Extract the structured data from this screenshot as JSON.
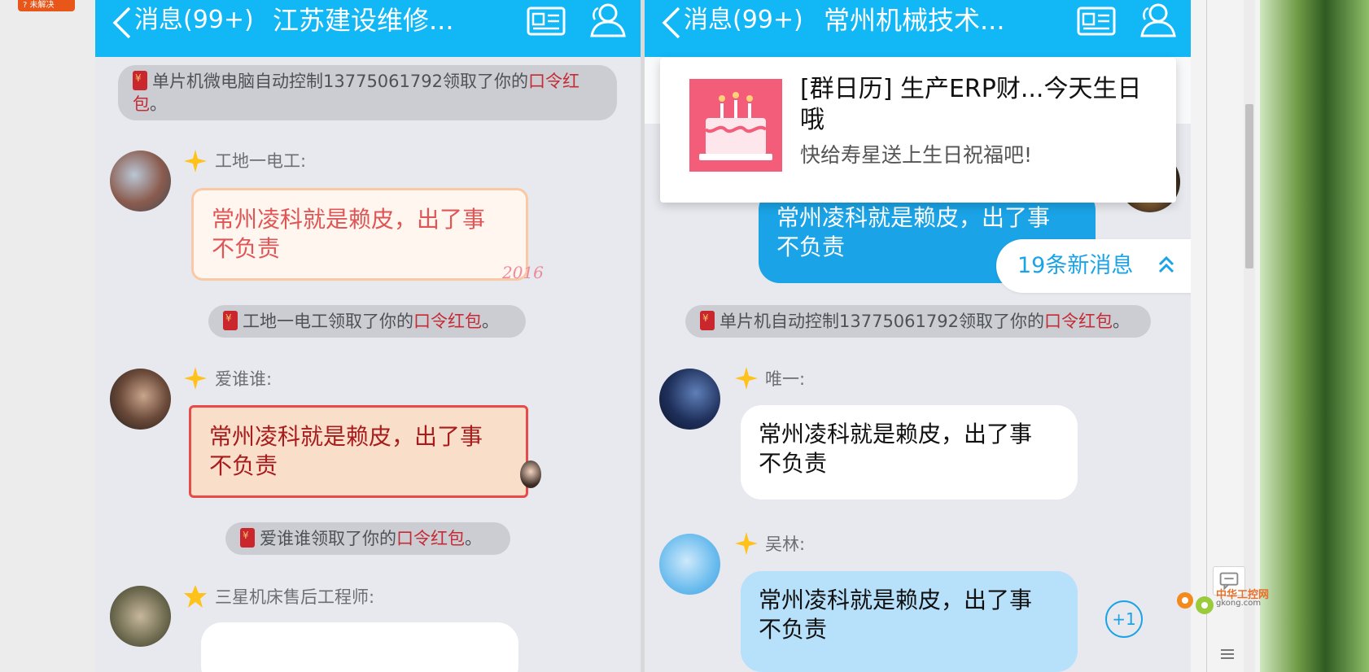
{
  "corner_badge": "? 未解决",
  "left_chat": {
    "back_label": "消息(99+)",
    "title": "江苏建设维修...",
    "notices": [
      {
        "prefix": "单片机微电脑自动控制13775061792领取了你的",
        "highlight": "口令红包",
        "suffix": "。"
      },
      {
        "prefix": "工地一电工领取了你的",
        "highlight": "口令红包",
        "suffix": "。"
      },
      {
        "prefix": "爱谁谁领取了你的",
        "highlight": "口令红包",
        "suffix": "。"
      }
    ],
    "messages": [
      {
        "sender": "工地一电工:",
        "text_line1": "常州凌科就是赖皮，出了事",
        "text_line2": "不负责",
        "sticker_text": "2016"
      },
      {
        "sender": "爱谁谁:",
        "text_line1": "常州凌科就是赖皮，出了事",
        "text_line2": "不负责"
      },
      {
        "sender": "三星机床售后工程师:"
      }
    ]
  },
  "right_chat": {
    "back_label": "消息(99+)",
    "title": "常州机械技术...",
    "popup": {
      "title": "[群日历] 生产ERP财...今天生日哦",
      "subtitle": "快给寿星送上生日祝福吧!"
    },
    "new_messages": "19条新消息",
    "notices": [
      {
        "prefix": "单片机自动控制13775061792领取了你的",
        "highlight": "口令红包",
        "suffix": "。"
      }
    ],
    "messages": [
      {
        "sender": "",
        "text_line1": "常州凌科就是赖皮，出了事",
        "text_line2": "不负责"
      },
      {
        "sender": "唯一:",
        "text_line1": "常州凌科就是赖皮，出了事",
        "text_line2": "不负责"
      },
      {
        "sender": "吴林:",
        "text_line1": "常州凌科就是赖皮，出了事",
        "text_line2": "不负责"
      }
    ],
    "plus_one": "+1"
  },
  "watermark": {
    "name": "中华工控网",
    "url": "gkong.com"
  },
  "colors": {
    "titlebar": "#12b7f5",
    "highlight": "#c42b35",
    "outgoing_bubble": "#1aa3e6"
  },
  "icons": [
    "chevron-left-icon",
    "contact-card-icon",
    "group-members-icon",
    "red-packet-icon",
    "vip-star-icon",
    "birthday-cake-icon",
    "chevron-up-icon",
    "chat-icon",
    "list-icon"
  ]
}
